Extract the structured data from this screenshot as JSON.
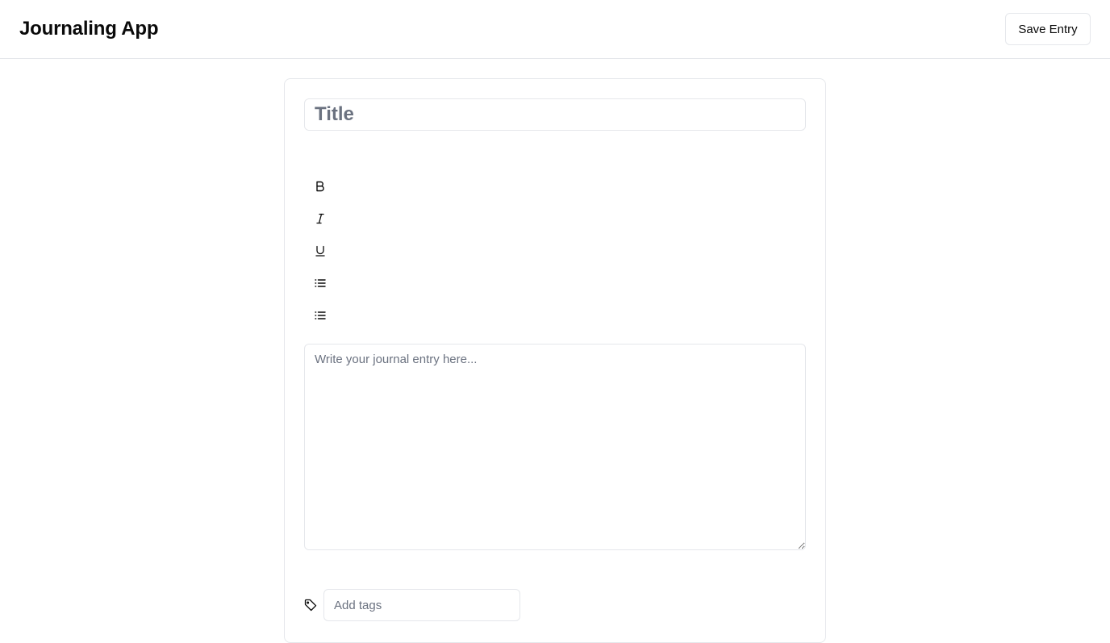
{
  "header": {
    "app_title": "Journaling App",
    "save_label": "Save Entry"
  },
  "editor": {
    "title_placeholder": "Title",
    "toolbar": [
      {
        "name": "bold-button",
        "icon": "bold-icon"
      },
      {
        "name": "italic-button",
        "icon": "italic-icon"
      },
      {
        "name": "underline-button",
        "icon": "underline-icon"
      },
      {
        "name": "bullet-list-button",
        "icon": "list-icon"
      },
      {
        "name": "numbered-list-button",
        "icon": "list-icon"
      }
    ],
    "body_placeholder": "Write your journal entry here...",
    "tags_placeholder": "Add tags"
  },
  "colors": {
    "border": "#e5e7eb",
    "placeholder": "#6b7280",
    "text": "#0a0a0a"
  }
}
